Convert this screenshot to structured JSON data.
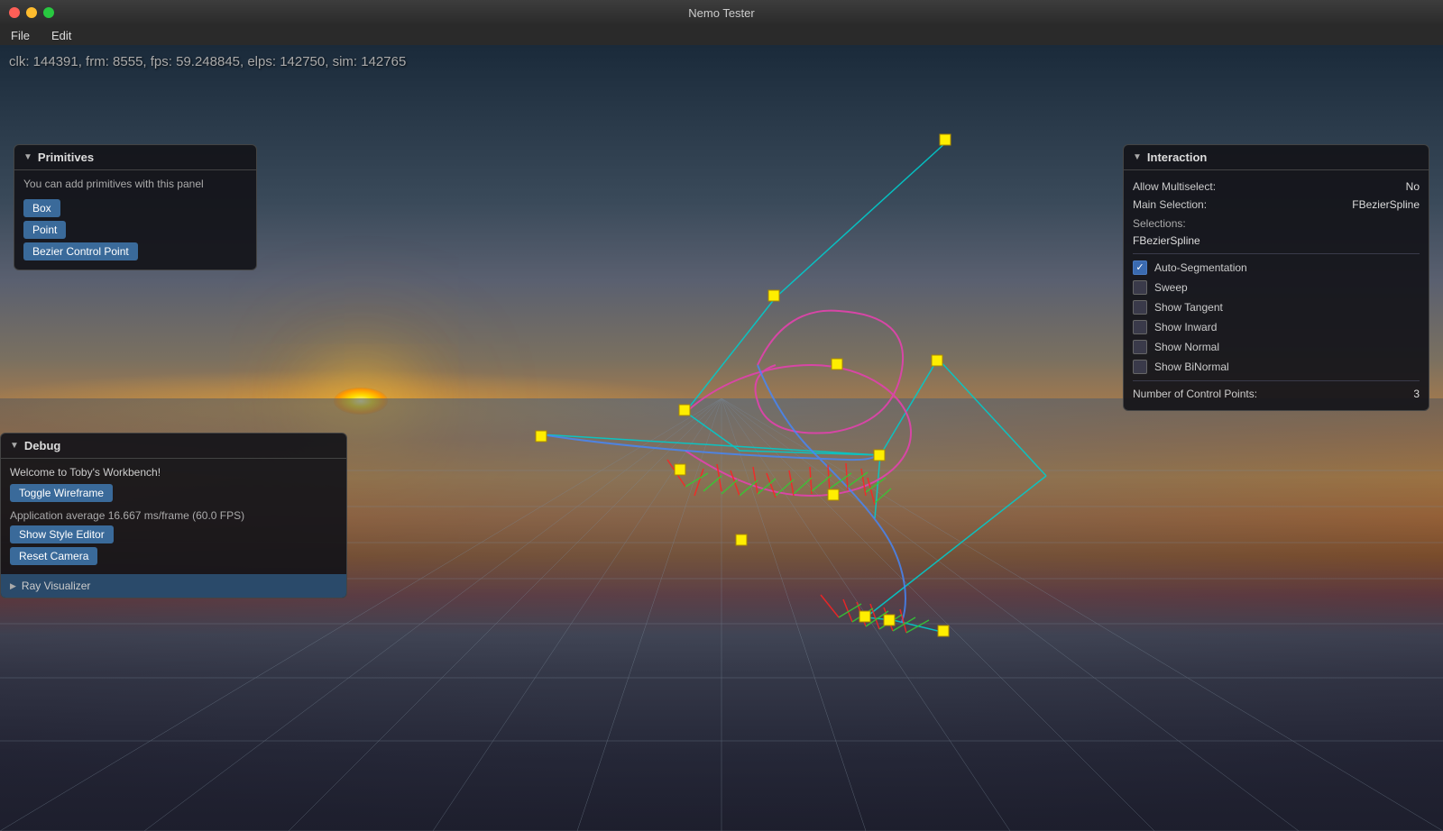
{
  "window": {
    "title": "Nemo Tester"
  },
  "menubar": {
    "items": [
      {
        "label": "File"
      },
      {
        "label": "Edit"
      }
    ]
  },
  "stats": {
    "text": "clk: 144391, frm: 8555, fps: 59.248845, elps: 142750, sim: 142765"
  },
  "primitives_panel": {
    "title": "Primitives",
    "description": "You can add primitives with this panel",
    "buttons": [
      {
        "label": "Box"
      },
      {
        "label": "Point"
      },
      {
        "label": "Bezier Control Point"
      }
    ]
  },
  "debug_panel": {
    "title": "Debug",
    "welcome": "Welcome to Toby's Workbench!",
    "fps_text": "Application average 16.667 ms/frame (60.0 FPS)",
    "buttons": [
      {
        "label": "Toggle Wireframe"
      },
      {
        "label": "Show Style Editor"
      },
      {
        "label": "Reset Camera"
      }
    ],
    "ray_visualizer": {
      "label": "Ray Visualizer"
    }
  },
  "interaction_panel": {
    "title": "Interaction",
    "allow_multiselect_label": "Allow Multiselect:",
    "allow_multiselect_value": "No",
    "main_selection_label": "Main Selection:",
    "main_selection_value": "FBezierSpline",
    "selections_label": "Selections:",
    "selections_value": "FBezierSpline",
    "checkboxes": [
      {
        "label": "Auto-Segmentation",
        "checked": true
      },
      {
        "label": "Sweep",
        "checked": false
      },
      {
        "label": "Show Tangent",
        "checked": false
      },
      {
        "label": "Show Inward",
        "checked": false
      },
      {
        "label": "Show Normal",
        "checked": false
      },
      {
        "label": "Show BiNormal",
        "checked": false
      }
    ],
    "control_points_label": "Number of Control Points:",
    "control_points_value": "3"
  }
}
